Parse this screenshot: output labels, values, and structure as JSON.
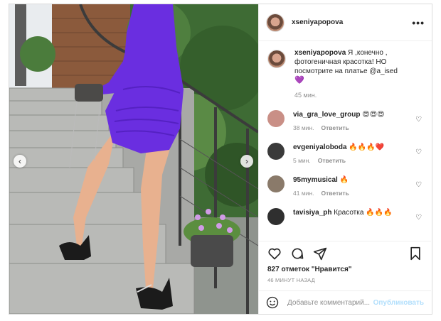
{
  "post": {
    "username": "xseniyapopova",
    "caption_text": "Я ,конечно , фотогеничная красотка! НО посмотрите на платье @a_ised",
    "caption_emoji": "💜",
    "caption_time": "45 мин."
  },
  "comments": [
    {
      "user": "via_gra_love_group",
      "text": "😍😍😍",
      "time": "38 мин.",
      "reply": "Ответить",
      "avatar_color": "#c98f86"
    },
    {
      "user": "evgeniyaloboda",
      "text": "🔥🔥🔥❤️",
      "time": "5 мин.",
      "reply": "Ответить",
      "avatar_color": "#3a3a3a"
    },
    {
      "user": "95mymusical",
      "text": "🔥",
      "time": "41 мин.",
      "reply": "Ответить",
      "avatar_color": "#8a7a6a"
    },
    {
      "user": "tavisiya_ph",
      "text": "Красотка 🔥🔥🔥",
      "time": "",
      "reply": "",
      "avatar_color": "#2f2f2f"
    }
  ],
  "actions": {
    "likes": "827 отметок",
    "liked_by": "\"Нравится\"",
    "timestamp": "46 МИНУТ НАЗАД",
    "icons": [
      "heart-icon",
      "comment-icon",
      "share-icon",
      "bookmark-icon"
    ]
  },
  "composer": {
    "placeholder": "Добавьте комментарий...",
    "post_label": "Опубликовать"
  },
  "photo": {
    "dress_color": "#6a2ee0",
    "nav_left": "‹",
    "nav_right": "›"
  }
}
